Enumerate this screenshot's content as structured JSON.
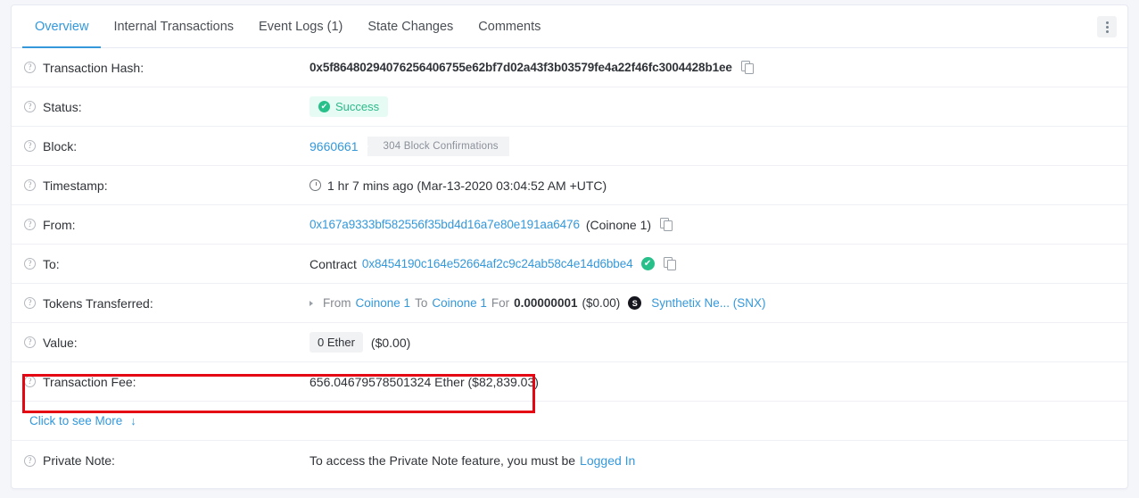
{
  "tabs": [
    {
      "label": "Overview",
      "active": true
    },
    {
      "label": "Internal Transactions",
      "active": false
    },
    {
      "label": "Event Logs (1)",
      "active": false
    },
    {
      "label": "State Changes",
      "active": false
    },
    {
      "label": "Comments",
      "active": false
    }
  ],
  "menu": {
    "kebab_title": "More options"
  },
  "rows": {
    "tx_hash": {
      "label": "Transaction Hash:",
      "value": "0x5f86480294076256406755e62bf7d02a43f3b03579fe4a22f46fc3004428b1ee"
    },
    "status": {
      "label": "Status:",
      "value": "Success",
      "check_glyph": "✔"
    },
    "block": {
      "label": "Block:",
      "number": "9660661",
      "confirmations": "304 Block Confirmations"
    },
    "timestamp": {
      "label": "Timestamp:",
      "value": "1 hr 7 mins ago (Mar-13-2020 03:04:52 AM +UTC)"
    },
    "from": {
      "label": "From:",
      "address": "0x167a9333bf582556f35bd4d16a7e80e191aa6476",
      "tag": "(Coinone 1)"
    },
    "to": {
      "label": "To:",
      "prefix": "Contract",
      "address": "0x8454190c164e52664af2c9c24ab58c4e14d6bbe4",
      "verified_glyph": "✔"
    },
    "tokens_transferred": {
      "label": "Tokens Transferred:",
      "from_word": "From",
      "from_name": "Coinone 1",
      "to_word": "To",
      "to_name": "Coinone 1",
      "for_word": "For",
      "amount": "0.00000001",
      "amount_usd": "($0.00)",
      "token_symbol_letter": "S",
      "token_name": "Synthetix Ne... (SNX)"
    },
    "value": {
      "label": "Value:",
      "ether": "0 Ether",
      "usd": "($0.00)"
    },
    "transaction_fee": {
      "label": "Transaction Fee:",
      "value": "656.04679578501324 Ether ($82,839.03)"
    },
    "see_more": {
      "label": "Click to see More",
      "arrow_glyph": "↓"
    },
    "private_note": {
      "label": "Private Note:",
      "text": "To access the Private Note feature, you must be",
      "link": "Logged In"
    }
  },
  "icons": {
    "help": "?",
    "copy": "copy-icon"
  },
  "colors": {
    "accent": "#3498db",
    "success": "#28c08a",
    "highlight": "#e40613",
    "text": "#2f3338",
    "muted": "#858a91"
  }
}
